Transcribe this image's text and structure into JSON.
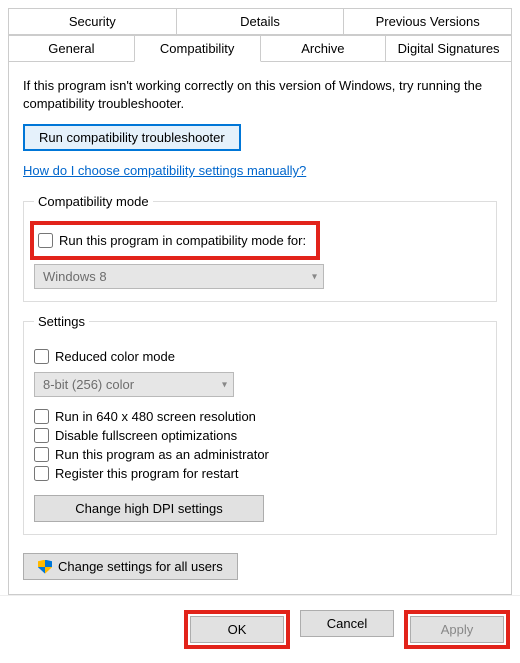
{
  "tabs": {
    "row1": [
      "Security",
      "Details",
      "Previous Versions"
    ],
    "row2": [
      "General",
      "Compatibility",
      "Archive",
      "Digital Signatures"
    ],
    "active": "Compatibility"
  },
  "intro": "If this program isn't working correctly on this version of Windows, try running the compatibility troubleshooter.",
  "troubleshooter_button": "Run compatibility troubleshooter",
  "manual_link": "How do I choose compatibility settings manually?",
  "compat_mode": {
    "legend": "Compatibility mode",
    "checkbox_label": "Run this program in compatibility mode for:",
    "dropdown_value": "Windows 8"
  },
  "settings": {
    "legend": "Settings",
    "reduced_color": "Reduced color mode",
    "color_dropdown": "8-bit (256) color",
    "run_640": "Run in 640 x 480 screen resolution",
    "disable_fullscreen": "Disable fullscreen optimizations",
    "run_admin": "Run this program as an administrator",
    "register_restart": "Register this program for restart",
    "dpi_button": "Change high DPI settings"
  },
  "all_users_button": "Change settings for all users",
  "buttons": {
    "ok": "OK",
    "cancel": "Cancel",
    "apply": "Apply"
  }
}
